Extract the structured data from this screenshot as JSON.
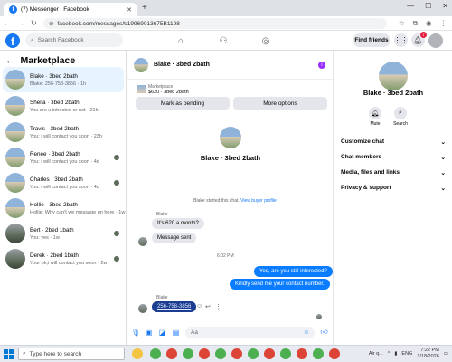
{
  "browser": {
    "tab_title": "(7) Messenger | Facebook",
    "url": "facebook.com/messages/t/19969013675B1198"
  },
  "fb": {
    "logo": "f",
    "search_placeholder": "Search Facebook",
    "find_friends": "Find friends",
    "notif_count": "7"
  },
  "sidebar": {
    "title": "Marketplace",
    "conversations": [
      {
        "title": "Blake · 3bed 2bath",
        "preview": "Blake: 256-758-3856 · 1h",
        "selected": true
      },
      {
        "title": "Shelia · 3bed 2bath",
        "preview": "You are u intrested or not · 21h"
      },
      {
        "title": "Travis · 3bed 2bath",
        "preview": "You: i will contact you soon · 23h"
      },
      {
        "title": "Renee · 3bed 2bath",
        "preview": "You: i will contact you soon · 4d"
      },
      {
        "title": "Charles · 3bed 2bath",
        "preview": "You: i will contact you soon · 4d"
      },
      {
        "title": "Hollie · 3bed 2bath",
        "preview": "Hollie: Why can't we message on here · 1w"
      },
      {
        "title": "Bert · 2bed 1bath",
        "preview": "You: yes · 1w"
      },
      {
        "title": "Derek · 2bed 1bath",
        "preview": "Your ok,i will contact you soon · 2w"
      }
    ]
  },
  "chat": {
    "header_name": "Blake · 3bed 2bath",
    "marketplace_label": "Marketplace",
    "listing": "$620 · 3bed 2bath",
    "mark_pending": "Mark as pending",
    "more_options": "More options",
    "convo_name": "Blake · 3bed 2bath",
    "started_text": "Blake started this chat.",
    "view_profile": "View buyer profile",
    "sender1": "Blake",
    "msg1": "It's 620 a month?",
    "msg2": "Message sent",
    "timestamp": "6:02 PM",
    "out1": "Yes, are you still interested?",
    "out2": "Kindly send me your contact number.",
    "sender2": "Blake",
    "phone": "256-758-3856",
    "compose_placeholder": "Aa"
  },
  "info": {
    "name": "Blake · 3bed 2bath",
    "mute": "Mute",
    "search": "Search",
    "rows": [
      "Customize chat",
      "Chat members",
      "Media, files and links",
      "Privacy & support"
    ]
  },
  "taskbar": {
    "search_placeholder": "Type here to search",
    "weather": "Air q...",
    "lang": "ENG",
    "time": "7:22 PM",
    "date": "1/18/2026"
  }
}
